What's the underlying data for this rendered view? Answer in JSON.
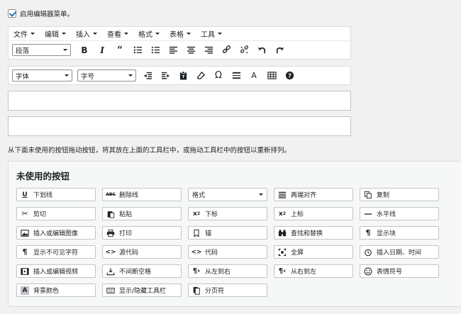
{
  "enable": {
    "label": "启用编辑器菜单。",
    "checked": true
  },
  "menubar": {
    "items": [
      "文件",
      "编辑",
      "插入",
      "查看",
      "格式",
      "表格",
      "工具"
    ]
  },
  "toolbar1": {
    "format_select": "段落"
  },
  "toolbar2": {
    "font_select": "字体",
    "size_select": "字号"
  },
  "hint": "从下面未使用的按钮拖动按钮，将其放在上面的工具栏中，或拖动工具栏中的按钮以重新排列。",
  "unused": {
    "title": "未使用的按钮",
    "buttons": [
      "下划线",
      "删除线",
      "格式",
      "两端对齐",
      "复制",
      "剪切",
      "粘贴",
      "下标",
      "上标",
      "水平线",
      "插入或编辑图像",
      "打印",
      "锚",
      "查找和替换",
      "显示块",
      "显示不可见字符",
      "源代码",
      "代码",
      "全屏",
      "插入日期、时间",
      "插入或编辑视频",
      "不间断空格",
      "从左到右",
      "从右到左",
      "表情符号",
      "背景颜色",
      "显示/隐藏工具栏",
      "分页符"
    ]
  },
  "icons": {
    "toolbar1": [
      "bold-icon",
      "italic-icon",
      "blockquote-icon",
      "bullet-list-icon",
      "numbered-list-icon",
      "align-left-icon",
      "align-center-icon",
      "align-right-icon",
      "link-icon",
      "unlink-icon",
      "undo-icon",
      "redo-icon"
    ],
    "toolbar2": [
      "outdent-icon",
      "indent-icon",
      "paste-as-text-icon",
      "clear-formatting-icon",
      "special-character-icon",
      "horizontal-line-icon",
      "text-color-icon",
      "table-icon",
      "help-icon"
    ]
  }
}
